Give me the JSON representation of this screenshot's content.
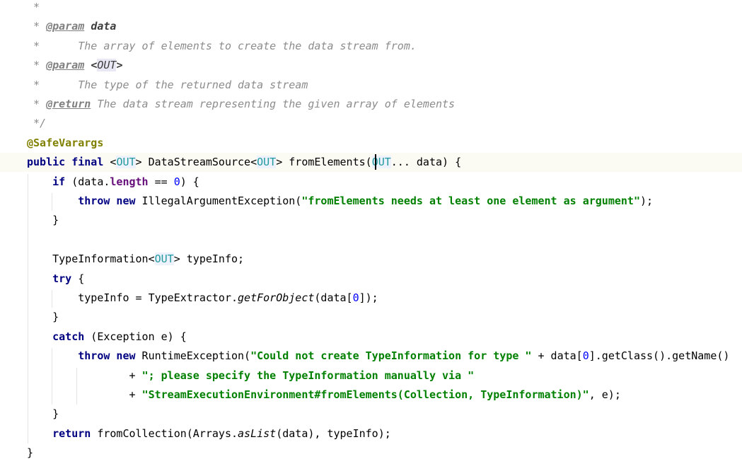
{
  "editor": {
    "lines": [
      {
        "segments": [
          {
            "c": "comment",
            "t": " *"
          }
        ]
      },
      {
        "segments": [
          {
            "c": "comment",
            "t": " * "
          },
          {
            "c": "doctag",
            "t": "@param"
          },
          {
            "c": "comment",
            "t": " "
          },
          {
            "c": "docval",
            "t": "data"
          }
        ]
      },
      {
        "segments": [
          {
            "c": "comment",
            "t": " *      The array of elements to create the data stream from."
          }
        ]
      },
      {
        "segments": [
          {
            "c": "comment",
            "t": " * "
          },
          {
            "c": "doctag",
            "t": "@param"
          },
          {
            "c": "comment",
            "t": " "
          },
          {
            "c": "docval",
            "t": "<"
          },
          {
            "c": "typeparam-box",
            "t": "OUT"
          },
          {
            "c": "docval",
            "t": ">"
          }
        ]
      },
      {
        "segments": [
          {
            "c": "comment",
            "t": " *      The type of the returned data stream"
          }
        ]
      },
      {
        "segments": [
          {
            "c": "comment",
            "t": " * "
          },
          {
            "c": "doctag",
            "t": "@return"
          },
          {
            "c": "comment",
            "t": " The data stream representing the given array of elements"
          }
        ]
      },
      {
        "segments": [
          {
            "c": "comment",
            "t": " */"
          }
        ]
      },
      {
        "segments": [
          {
            "c": "ann",
            "t": "@SafeVarargs"
          }
        ]
      },
      {
        "current": true,
        "segments": [
          {
            "c": "kw",
            "t": "public final "
          },
          {
            "c": "plain",
            "t": "<"
          },
          {
            "c": "tp",
            "t": "OUT"
          },
          {
            "c": "plain",
            "t": "> DataStreamSource<"
          },
          {
            "c": "tp",
            "t": "OUT"
          },
          {
            "c": "plain",
            "t": "> fromElements("
          },
          {
            "c": "tp",
            "t": "OUT"
          },
          {
            "c": "plain",
            "t": "... data) {"
          }
        ]
      },
      {
        "segments": [
          {
            "c": "plain",
            "t": "    "
          },
          {
            "c": "kw",
            "t": "if"
          },
          {
            "c": "plain",
            "t": " (data."
          },
          {
            "c": "field",
            "t": "length"
          },
          {
            "c": "plain",
            "t": " == "
          },
          {
            "c": "num",
            "t": "0"
          },
          {
            "c": "plain",
            "t": ") {"
          }
        ]
      },
      {
        "segments": [
          {
            "c": "plain",
            "t": "        "
          },
          {
            "c": "kw",
            "t": "throw new"
          },
          {
            "c": "plain",
            "t": " IllegalArgumentException("
          },
          {
            "c": "str",
            "t": "\"fromElements needs at least one element as argument\""
          },
          {
            "c": "plain",
            "t": ");"
          }
        ]
      },
      {
        "segments": [
          {
            "c": "plain",
            "t": "    }"
          }
        ]
      },
      {
        "segments": [
          {
            "c": "plain",
            "t": ""
          }
        ]
      },
      {
        "segments": [
          {
            "c": "plain",
            "t": "    TypeInformation<"
          },
          {
            "c": "tp",
            "t": "OUT"
          },
          {
            "c": "plain",
            "t": "> typeInfo;"
          }
        ]
      },
      {
        "segments": [
          {
            "c": "plain",
            "t": "    "
          },
          {
            "c": "kw",
            "t": "try"
          },
          {
            "c": "plain",
            "t": " {"
          }
        ]
      },
      {
        "segments": [
          {
            "c": "plain",
            "t": "        typeInfo = TypeExtractor."
          },
          {
            "c": "static",
            "t": "getForObject"
          },
          {
            "c": "plain",
            "t": "(data["
          },
          {
            "c": "num",
            "t": "0"
          },
          {
            "c": "plain",
            "t": "]);"
          }
        ]
      },
      {
        "segments": [
          {
            "c": "plain",
            "t": "    }"
          }
        ]
      },
      {
        "segments": [
          {
            "c": "plain",
            "t": "    "
          },
          {
            "c": "kw",
            "t": "catch"
          },
          {
            "c": "plain",
            "t": " (Exception e) {"
          }
        ]
      },
      {
        "segments": [
          {
            "c": "plain",
            "t": "        "
          },
          {
            "c": "kw",
            "t": "throw new"
          },
          {
            "c": "plain",
            "t": " RuntimeException("
          },
          {
            "c": "str",
            "t": "\"Could not create TypeInformation for type \""
          },
          {
            "c": "plain",
            "t": " + data["
          },
          {
            "c": "num",
            "t": "0"
          },
          {
            "c": "plain",
            "t": "].getClass().getName()"
          }
        ]
      },
      {
        "segments": [
          {
            "c": "plain",
            "t": "                + "
          },
          {
            "c": "str",
            "t": "\"; please specify the TypeInformation manually via \""
          }
        ]
      },
      {
        "segments": [
          {
            "c": "plain",
            "t": "                + "
          },
          {
            "c": "str",
            "t": "\"StreamExecutionEnvironment#fromElements(Collection, TypeInformation)\""
          },
          {
            "c": "plain",
            "t": ", e);"
          }
        ]
      },
      {
        "segments": [
          {
            "c": "plain",
            "t": "    }"
          }
        ]
      },
      {
        "segments": [
          {
            "c": "plain",
            "t": "    "
          },
          {
            "c": "kw",
            "t": "return"
          },
          {
            "c": "plain",
            "t": " fromCollection(Arrays."
          },
          {
            "c": "static",
            "t": "asList"
          },
          {
            "c": "plain",
            "t": "(data), typeInfo);"
          }
        ]
      },
      {
        "segments": [
          {
            "c": "plain",
            "t": "}"
          }
        ]
      }
    ]
  }
}
